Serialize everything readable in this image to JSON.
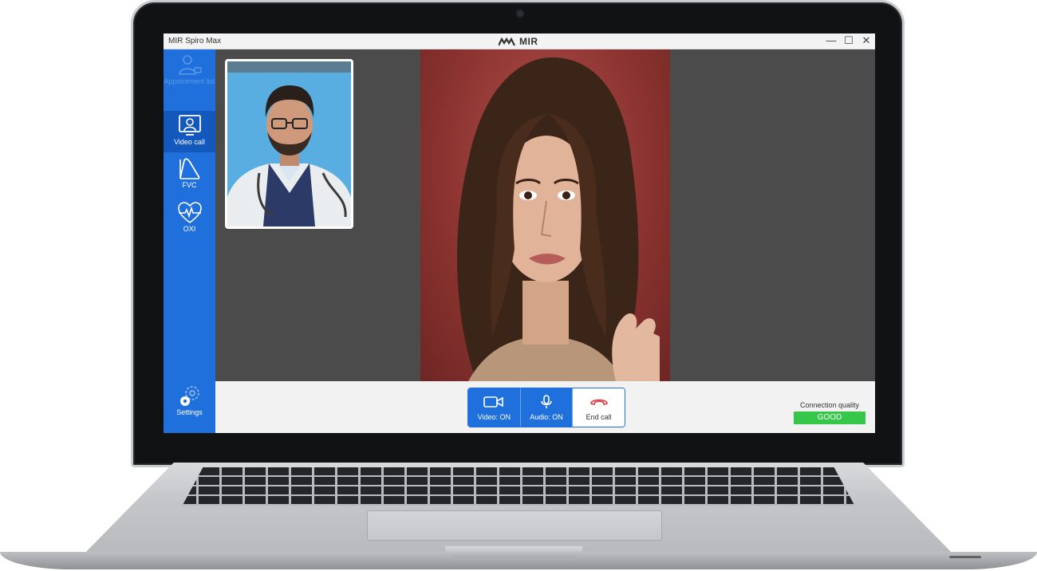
{
  "window": {
    "title": "MIR Spiro Max",
    "brand": "MIR",
    "minimize_label": "—",
    "maximize_label": "☐",
    "close_label": "✕"
  },
  "sidebar": {
    "items": [
      {
        "label": "Appointment list",
        "icon": "appointment-list-icon",
        "state": "disabled"
      },
      {
        "label": "Video call",
        "icon": "video-call-monitor-icon",
        "state": "active"
      },
      {
        "label": "FVC",
        "icon": "fvc-curve-icon",
        "state": "normal"
      },
      {
        "label": "OXI",
        "icon": "heart-pulse-icon",
        "state": "normal"
      }
    ],
    "settings_label": "Settings"
  },
  "controls": {
    "video_label": "Video: ON",
    "audio_label": "Audio: ON",
    "end_label": "End call"
  },
  "connection": {
    "label": "Connection quality",
    "status": "GOOD"
  },
  "colors": {
    "sidebar_blue": "#1f70dd",
    "active_blue": "#1359bd",
    "good_green": "#36c64a",
    "end_call_red": "#e0393e"
  }
}
